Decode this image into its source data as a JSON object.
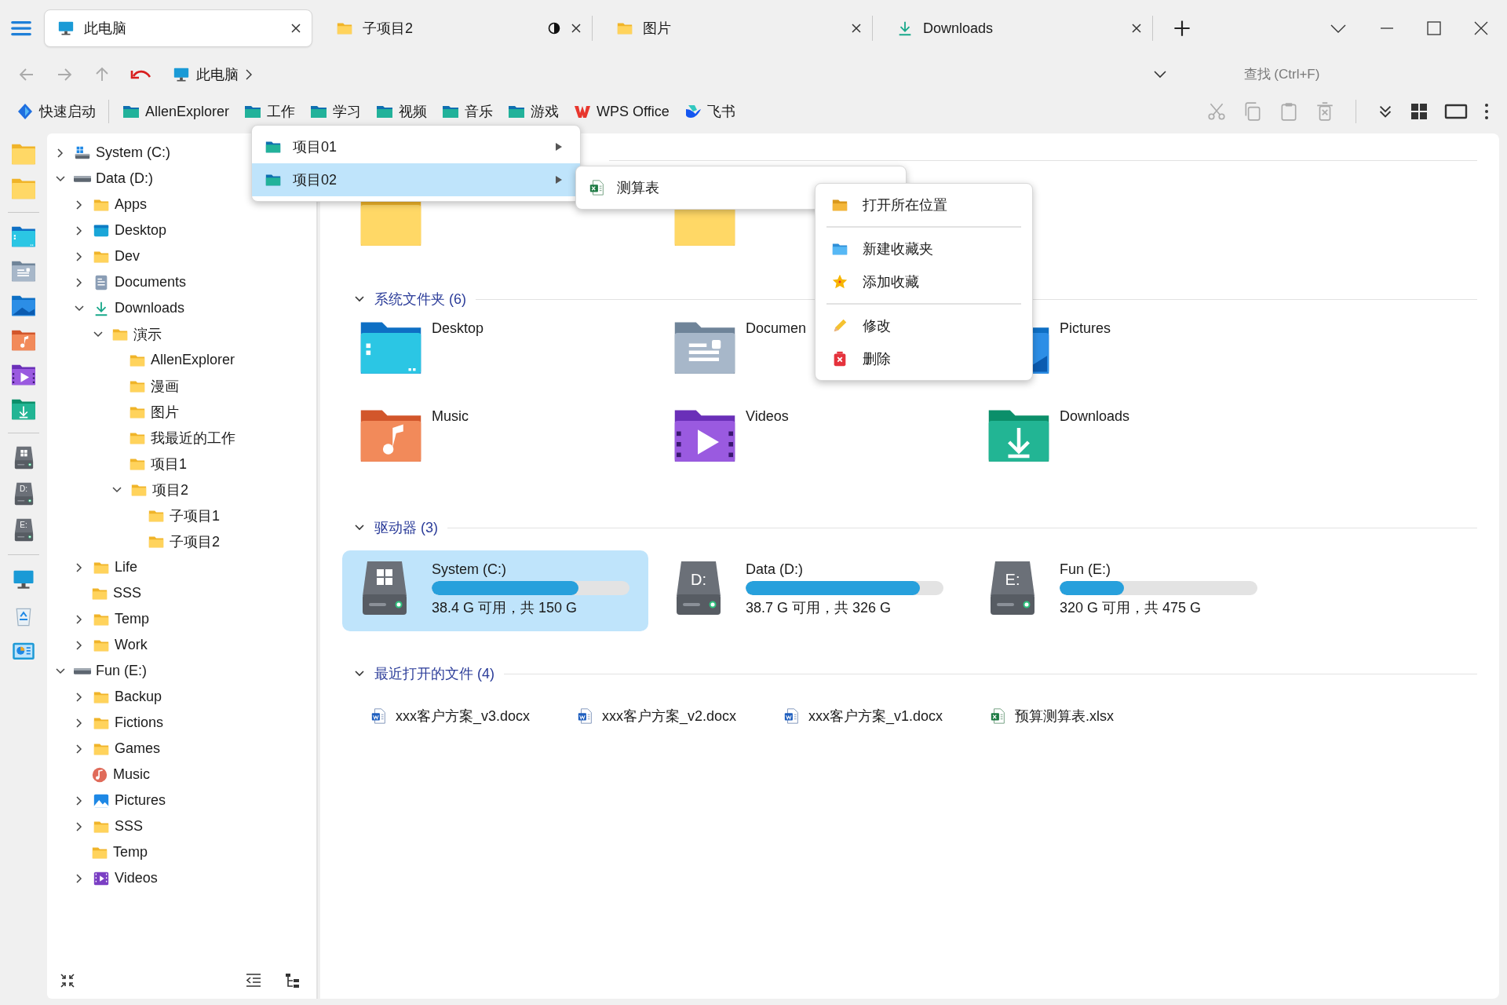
{
  "tabs": [
    {
      "label": "此电脑",
      "kind": "computer",
      "selected": true,
      "marked": false
    },
    {
      "label": "子项目2",
      "kind": "folder",
      "selected": false,
      "marked": true
    },
    {
      "label": "图片",
      "kind": "folder",
      "selected": false,
      "marked": false
    },
    {
      "label": "Downloads",
      "kind": "downloads",
      "selected": false,
      "marked": false
    }
  ],
  "address": {
    "crumbs": [
      "此电脑"
    ]
  },
  "search": {
    "placeholder": "查找 (Ctrl+F)"
  },
  "bookmarks": [
    {
      "label": "快速启动",
      "kind": "launch"
    },
    {
      "label": "AllenExplorer",
      "kind": "teal-folder"
    },
    {
      "label": "工作",
      "kind": "teal-folder"
    },
    {
      "label": "学习",
      "kind": "teal-folder"
    },
    {
      "label": "视频",
      "kind": "teal-folder"
    },
    {
      "label": "音乐",
      "kind": "teal-folder"
    },
    {
      "label": "游戏",
      "kind": "teal-folder"
    },
    {
      "label": "WPS Office",
      "kind": "wps"
    },
    {
      "label": "飞书",
      "kind": "feishu"
    }
  ],
  "tree": [
    {
      "label": "System (C:)",
      "kind": "drive-windows",
      "expandable": true,
      "expanded": false
    },
    {
      "label": "Data (D:)",
      "kind": "drive",
      "expandable": true,
      "expanded": true,
      "children": [
        {
          "label": "Apps",
          "kind": "folder",
          "expandable": true,
          "expanded": false
        },
        {
          "label": "Desktop",
          "kind": "desktop",
          "expandable": true,
          "expanded": false
        },
        {
          "label": "Dev",
          "kind": "folder",
          "expandable": true,
          "expanded": false
        },
        {
          "label": "Documents",
          "kind": "documents",
          "expandable": true,
          "expanded": false
        },
        {
          "label": "Downloads",
          "kind": "downloads",
          "expandable": true,
          "expanded": true,
          "children": [
            {
              "label": "演示",
              "kind": "folder",
              "expandable": true,
              "expanded": true,
              "children": [
                {
                  "label": "AllenExplorer",
                  "kind": "folder",
                  "expandable": false,
                  "expanded": false
                },
                {
                  "label": "漫画",
                  "kind": "folder",
                  "expandable": false,
                  "expanded": false
                },
                {
                  "label": "图片",
                  "kind": "folder",
                  "expandable": false,
                  "expanded": false
                },
                {
                  "label": "我最近的工作",
                  "kind": "folder",
                  "expandable": false,
                  "expanded": false
                },
                {
                  "label": "项目1",
                  "kind": "folder",
                  "expandable": false,
                  "expanded": false
                },
                {
                  "label": "项目2",
                  "kind": "folder",
                  "expandable": true,
                  "expanded": true,
                  "children": [
                    {
                      "label": "子项目1",
                      "kind": "folder",
                      "expandable": false,
                      "expanded": false
                    },
                    {
                      "label": "子项目2",
                      "kind": "folder",
                      "expandable": false,
                      "expanded": false
                    }
                  ]
                }
              ]
            }
          ]
        },
        {
          "label": "Life",
          "kind": "folder",
          "expandable": true,
          "expanded": false
        },
        {
          "label": "SSS",
          "kind": "folder",
          "expandable": false,
          "expanded": false
        },
        {
          "label": "Temp",
          "kind": "folder",
          "expandable": true,
          "expanded": false
        },
        {
          "label": "Work",
          "kind": "folder",
          "expandable": true,
          "expanded": false
        }
      ]
    },
    {
      "label": "Fun (E:)",
      "kind": "drive",
      "expandable": true,
      "expanded": true,
      "children": [
        {
          "label": "Backup",
          "kind": "folder",
          "expandable": true,
          "expanded": false
        },
        {
          "label": "Fictions",
          "kind": "folder",
          "expandable": true,
          "expanded": false
        },
        {
          "label": "Games",
          "kind": "folder",
          "expandable": true,
          "expanded": false
        },
        {
          "label": "Music",
          "kind": "music",
          "expandable": false,
          "expanded": false
        },
        {
          "label": "Pictures",
          "kind": "pictures",
          "expandable": true,
          "expanded": false
        },
        {
          "label": "SSS",
          "kind": "folder",
          "expandable": true,
          "expanded": false
        },
        {
          "label": "Temp",
          "kind": "folder",
          "expandable": false,
          "expanded": false
        },
        {
          "label": "Videos",
          "kind": "videos",
          "expandable": true,
          "expanded": false
        }
      ]
    }
  ],
  "sidebar_drives": [
    {
      "kind": "windows"
    },
    {
      "kind": "letter",
      "letter": "D:"
    },
    {
      "kind": "letter",
      "letter": "E:"
    }
  ],
  "pinned": {
    "items": [
      {
        "kind": "folder"
      },
      {
        "kind": "folder"
      }
    ]
  },
  "sections": [
    {
      "kind": "folders",
      "title": "系统文件夹 (6)",
      "expanded": true,
      "items": [
        {
          "label": "Desktop",
          "kind": "desktop"
        },
        {
          "label": "Documen",
          "kind": "documents"
        },
        {
          "label": "Pictures",
          "kind": "pictures"
        },
        {
          "label": "Music",
          "kind": "music"
        },
        {
          "label": "Videos",
          "kind": "videos"
        },
        {
          "label": "Downloads",
          "kind": "downloads"
        }
      ]
    },
    {
      "kind": "drives",
      "title": "驱动器 (3)",
      "expanded": true,
      "items": [
        {
          "label": "System (C:)",
          "kind": "windows",
          "level": 0.744,
          "info": "38.4 G 可用，共 150 G",
          "selected": true
        },
        {
          "label": "Data (D:)",
          "kind": "letter",
          "letter": "D:",
          "level": 0.881,
          "info": "38.7 G 可用，共 326 G",
          "selected": false
        },
        {
          "label": "Fun (E:)",
          "kind": "letter",
          "letter": "E:",
          "level": 0.326,
          "info": "320 G 可用，共 475 G",
          "selected": false
        }
      ]
    },
    {
      "kind": "files",
      "title": "最近打开的文件 (4)",
      "expanded": true,
      "items": [
        {
          "label": "xxx客户方案_v3.docx",
          "kind": "word"
        },
        {
          "label": "xxx客户方案_v2.docx",
          "kind": "word"
        },
        {
          "label": "xxx客户方案_v1.docx",
          "kind": "word"
        },
        {
          "label": "预算测算表.xlsx",
          "kind": "excel"
        }
      ]
    }
  ],
  "flyout_menus": [
    {
      "items": [
        {
          "label": "项目01",
          "kind": "teal-folder",
          "submenu": true,
          "selected": false
        },
        {
          "label": "项目02",
          "kind": "teal-folder",
          "submenu": true,
          "selected": true
        }
      ]
    },
    {
      "items": [
        {
          "label": "测算表",
          "kind": "excel",
          "submenu": false,
          "selected": false
        }
      ]
    }
  ],
  "context_menu": {
    "groups": [
      [
        {
          "label": "打开所在位置",
          "kind": "open-folder"
        }
      ],
      [
        {
          "label": "新建收藏夹",
          "kind": "new-folder"
        },
        {
          "label": "添加收藏",
          "kind": "star"
        }
      ],
      [
        {
          "label": "修改",
          "kind": "pencil"
        },
        {
          "label": "删除",
          "kind": "delete"
        }
      ]
    ]
  }
}
